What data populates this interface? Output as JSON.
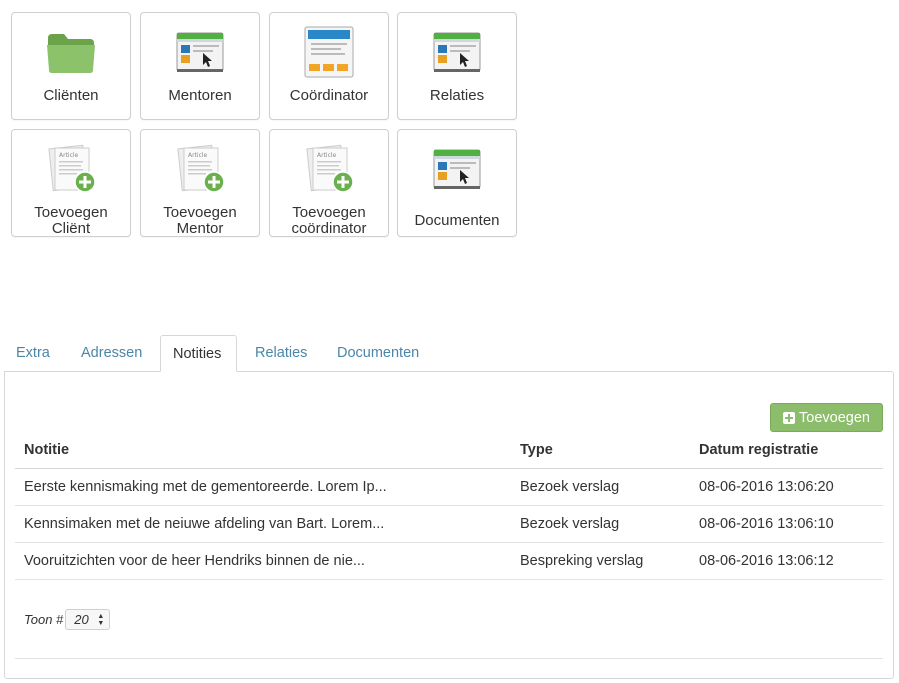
{
  "tiles": [
    {
      "id": "clienten",
      "label_lines": [
        "Cliënten"
      ],
      "icon": "folder-icon"
    },
    {
      "id": "mentoren",
      "label_lines": [
        "Mentoren"
      ],
      "icon": "browser-window-icon"
    },
    {
      "id": "coordinator",
      "label_lines": [
        "Coördinator"
      ],
      "icon": "webpage-layout-icon"
    },
    {
      "id": "relaties",
      "label_lines": [
        "Relaties"
      ],
      "icon": "browser-window-icon"
    },
    {
      "id": "toevoegen-client",
      "label_lines": [
        "Toevoegen",
        "Cliënt"
      ],
      "icon": "add-article-icon"
    },
    {
      "id": "toevoegen-mentor",
      "label_lines": [
        "Toevoegen",
        "Mentor"
      ],
      "icon": "add-article-icon"
    },
    {
      "id": "toevoegen-coordinator",
      "label_lines": [
        "Toevoegen",
        "coördinator"
      ],
      "icon": "add-article-icon"
    },
    {
      "id": "documenten",
      "label_lines": [
        "Documenten"
      ],
      "icon": "browser-window-icon"
    }
  ],
  "tabs": [
    {
      "label": "Extra",
      "active": false
    },
    {
      "label": "Adressen",
      "active": false
    },
    {
      "label": "Notities",
      "active": true
    },
    {
      "label": "Relaties",
      "active": false
    },
    {
      "label": "Documenten",
      "active": false
    }
  ],
  "panel": {
    "add_button_label": "Toevoegen",
    "columns": [
      "Notitie",
      "Type",
      "Datum registratie"
    ],
    "rows": [
      [
        "Eerste kennismaking met de gementoreerde. Lorem Ip...",
        "Bezoek verslag",
        "08-06-2016 13:06:20"
      ],
      [
        "Kennsimaken met de neiuwe afdeling van Bart. Lorem...",
        "Bezoek verslag",
        "08-06-2016 13:06:10"
      ],
      [
        "Vooruitzichten voor de heer Hendriks binnen de nie...",
        "Bespreking verslag",
        "08-06-2016 13:06:12"
      ]
    ],
    "pager": {
      "label": "Toon #",
      "selected": "20"
    }
  },
  "colors": {
    "accent_green": "#8bbd6a",
    "link_blue": "#4a86a8",
    "icon_folder": "#7cb35a"
  }
}
